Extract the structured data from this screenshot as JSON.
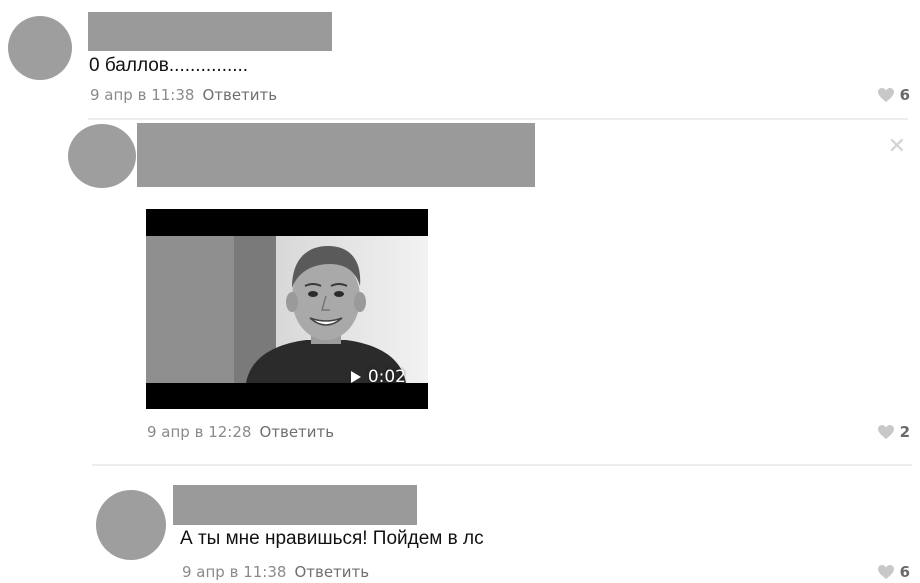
{
  "comments": [
    {
      "text": "0 баллов...............",
      "date": "9 апр в 11:38",
      "reply_label": "Ответить",
      "likes": "6"
    },
    {
      "text": "",
      "date": "9 апр в 12:28",
      "reply_label": "Ответить",
      "likes": "2",
      "attachment": {
        "type": "video",
        "duration": "0:02"
      }
    },
    {
      "text": "А ты мне нравишься! Пойдем в лс",
      "date": "9 апр в 11:38",
      "reply_label": "Ответить",
      "likes": "6"
    }
  ],
  "icons": {
    "like": "heart-icon",
    "delete": "close-icon",
    "play": "play-icon"
  },
  "colors": {
    "avatar": "#9e9e9e",
    "redaction": "#9a9a9a",
    "meta_text": "#8a8a8a",
    "like_heart": "#c8c8c8"
  }
}
